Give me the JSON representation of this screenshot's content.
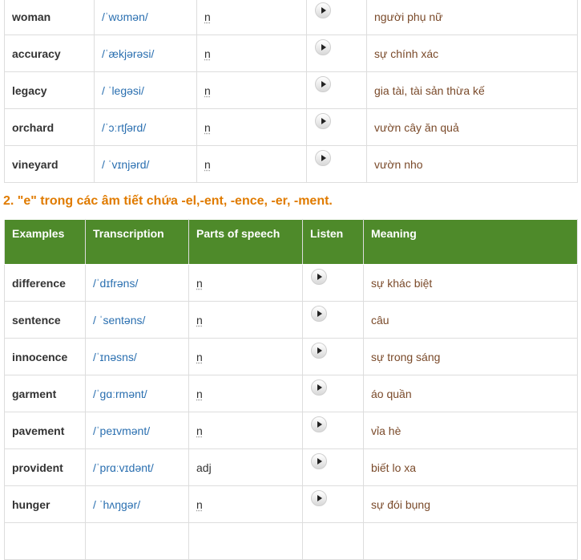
{
  "table1": {
    "rows": [
      {
        "word": "woman",
        "ipa": "/ˈwʊmən/",
        "pos": "n",
        "meaning": "người phụ nữ"
      },
      {
        "word": "accuracy",
        "ipa": "/ˈækjərəsi/",
        "pos": "n",
        "meaning": "sự chính xác"
      },
      {
        "word": "legacy",
        "ipa": "/ ˈlegəsi/",
        "pos": "n",
        "meaning": "gia tài, tài sản thừa kế"
      },
      {
        "word": "orchard",
        "ipa": "/ˈɔːrtʃərd/",
        "pos": "n",
        "meaning": "vườn cây ăn quả"
      },
      {
        "word": "vineyard",
        "ipa": "/ ˈvɪnjərd/",
        "pos": "n",
        "meaning": "vườn nho"
      }
    ]
  },
  "section2": {
    "heading": "2. \"e\" trong các âm tiết chứa -el,-ent, -ence, -er, -ment.",
    "headers": [
      "Examples",
      "Transcription",
      "Parts of speech",
      "Listen",
      "Meaning"
    ],
    "rows": [
      {
        "word": "difference",
        "ipa": "/ˈdɪfrəns/",
        "pos": "n",
        "meaning": "sự khác biệt"
      },
      {
        "word": "sentence",
        "ipa": "/ ˈsentəns/",
        "pos": "n",
        "meaning": "câu"
      },
      {
        "word": "innocence",
        "ipa": "/ˈɪnəsns/",
        "pos": "n",
        "meaning": "sự trong sáng"
      },
      {
        "word": "garment",
        "ipa": "/ˈɡɑːrmənt/",
        "pos": "n",
        "meaning": "áo quần"
      },
      {
        "word": "pavement",
        "ipa": "/ˈpeɪvmənt/",
        "pos": "n",
        "meaning": "vỉa hè"
      },
      {
        "word": "provident",
        "ipa": "/ˈprɑːvɪdənt/",
        "pos": "adj",
        "meaning": "biết lo xa"
      },
      {
        "word": "hunger",
        "ipa": "/ ˈhʌŋɡər/",
        "pos": "n",
        "meaning": "sự đói bụng"
      }
    ]
  },
  "icons": {
    "play": "play-button-icon"
  },
  "colors": {
    "heading": "#e07b00",
    "header_bg": "#4e8a2a",
    "ipa": "#2a6fb0",
    "meaning": "#7a4a2a"
  }
}
